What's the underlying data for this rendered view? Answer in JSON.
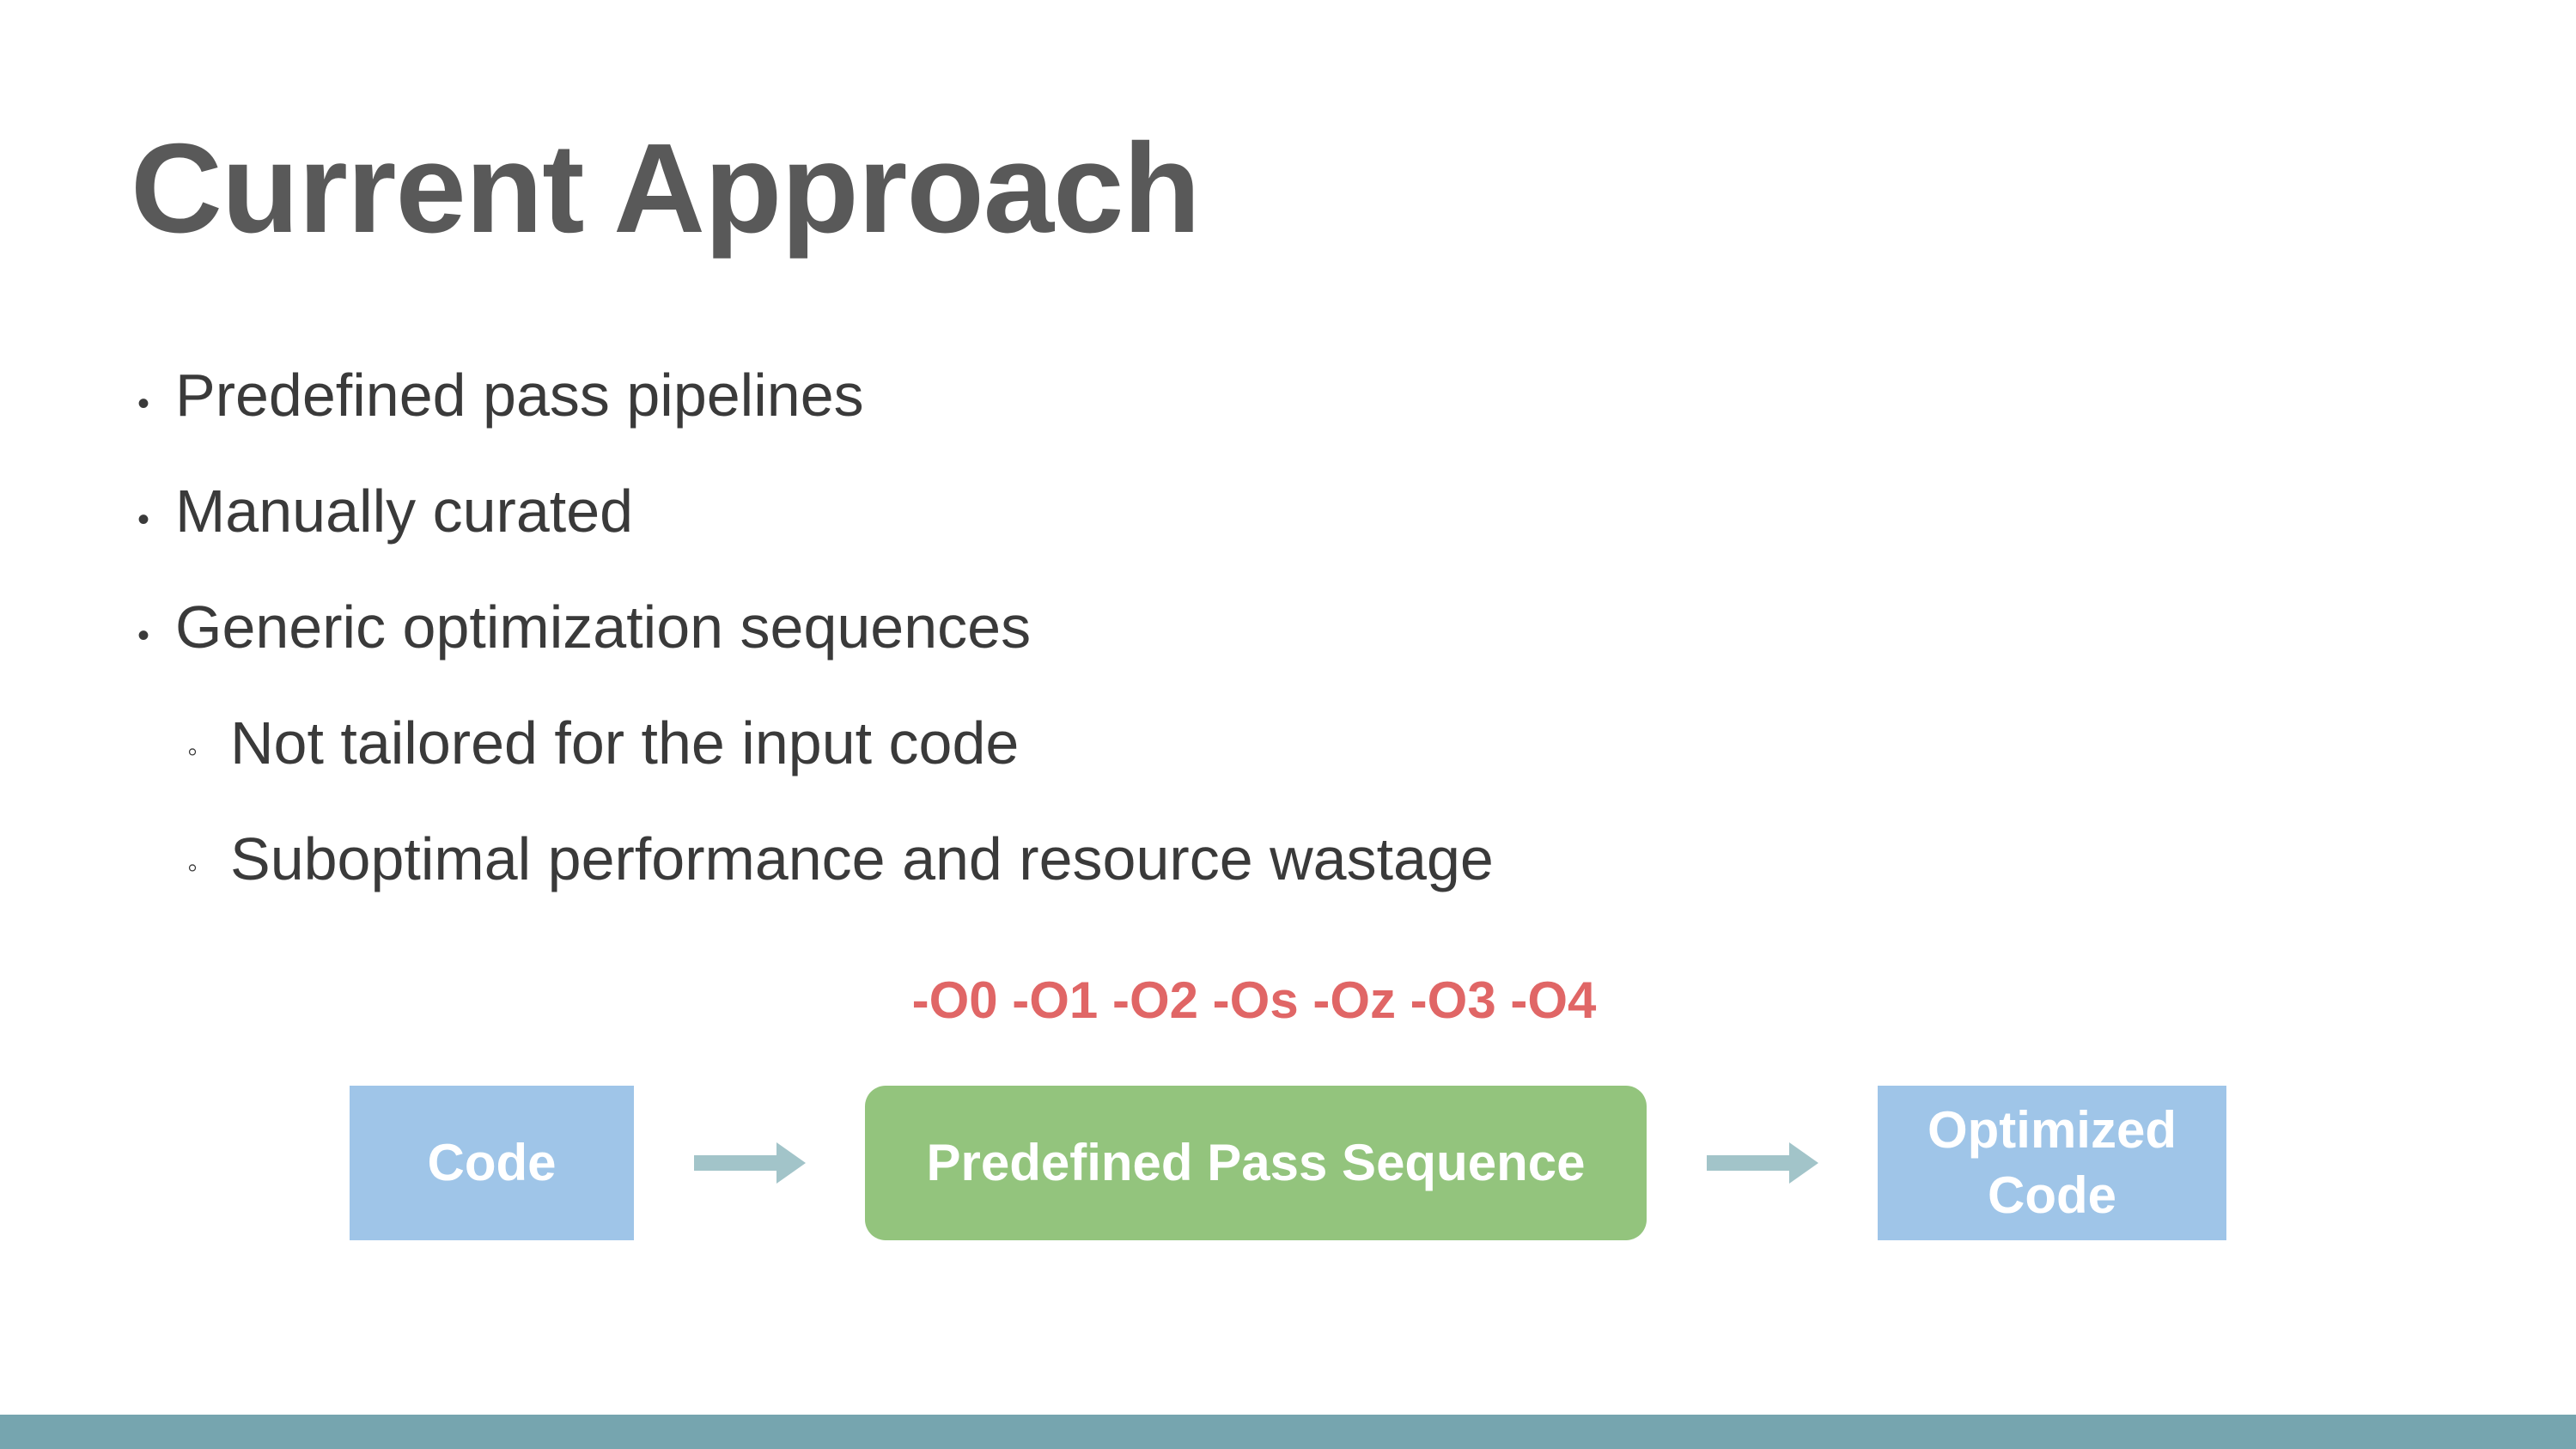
{
  "slide": {
    "title": "Current Approach",
    "bullets": [
      {
        "level": 1,
        "marker": "•",
        "text": "Predefined pass pipelines"
      },
      {
        "level": 1,
        "marker": "•",
        "text": "Manually curated"
      },
      {
        "level": 1,
        "marker": "•",
        "text": "Generic optimization sequences"
      },
      {
        "level": 2,
        "marker": "◦",
        "text": "Not tailored for the input code"
      },
      {
        "level": 2,
        "marker": "◦",
        "text": "Suboptimal performance and resource wastage"
      }
    ]
  },
  "diagram": {
    "flags": "-O0 -O1 -O2 -Os -Oz -O3 -O4",
    "nodes": {
      "code": "Code",
      "pass_sequence": "Predefined Pass Sequence",
      "optimized_line1": "Optimized",
      "optimized_line2": "Code"
    }
  },
  "colors": {
    "title": "#595959",
    "body_text": "#3a3a3a",
    "flags": "#e06666",
    "code_box": "#9fc5e8",
    "pass_box": "#93c47d",
    "arrow": "#a2c4c9",
    "footer_bar": "#76a5af"
  }
}
